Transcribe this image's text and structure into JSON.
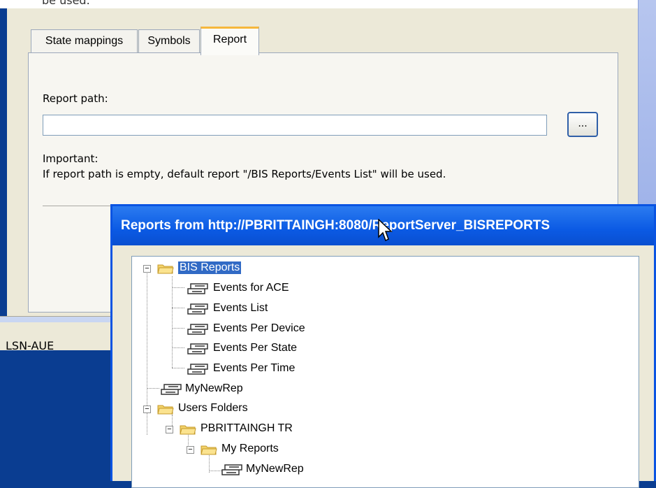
{
  "top_cut_text": "be used.",
  "tabs": [
    "State mappings",
    "Symbols",
    "Report"
  ],
  "report_path_label": "Report path:",
  "report_path_value": "",
  "browse_button": "...",
  "important_label": "Important:",
  "important_text": "If report path is empty, default report \"/BIS Reports/Events List\" will be used.",
  "status_text": "LSN-AUE",
  "dialog": {
    "title": "Reports from http://PBRITTAINGH:8080/ReportServer_BISREPORTS",
    "tree": {
      "bis_reports": "BIS Reports",
      "events_for_ace": "Events for ACE",
      "events_list": "Events List",
      "events_per_device": "Events Per Device",
      "events_per_state": "Events Per State",
      "events_per_time": "Events Per Time",
      "mynewrep_root": "MyNewRep",
      "users_folders": "Users Folders",
      "pbrittaingh_tr": "PBRITTAINGH TR",
      "my_reports": "My Reports",
      "mynewrep_user": "MyNewRep"
    }
  },
  "colors": {
    "title_bar": "#0b5ae4",
    "selection": "#316ac5",
    "active_tab_accent": "#f6b73c",
    "desktop": "#0a3d91"
  }
}
